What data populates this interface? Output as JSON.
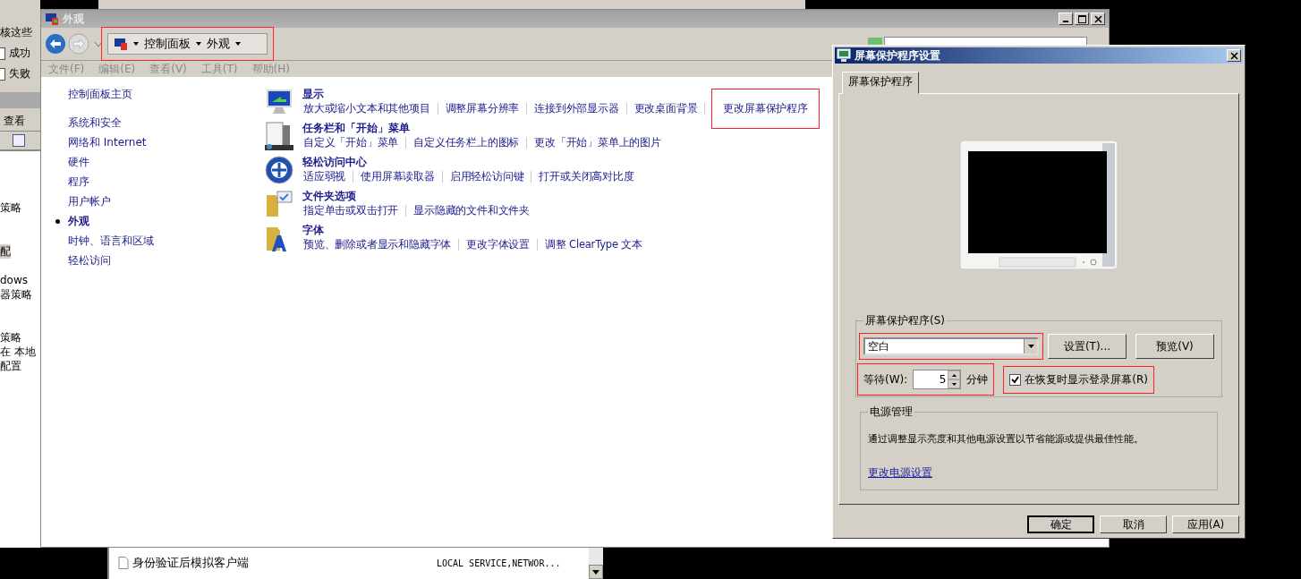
{
  "left_window": {
    "header": "核这些",
    "checkboxes": [
      {
        "label": "成功",
        "checked": false
      },
      {
        "label": "失败",
        "checked": false
      }
    ],
    "menu": [
      "查看"
    ],
    "items": [
      {
        "text": "策略",
        "selected": false
      },
      {
        "text": "配",
        "selected": true
      },
      {
        "text": "dows",
        "selected": false
      },
      {
        "text": "器策略",
        "selected": false
      },
      {
        "text": "策略",
        "selected": false
      },
      {
        "text": "在 本地",
        "selected": false
      },
      {
        "text": "配置",
        "selected": false
      }
    ]
  },
  "list_window": {
    "rows": [
      {
        "name": "身份验证后模拟客户端",
        "column_2": "LOCAL SERVICE,NETWOR..."
      }
    ]
  },
  "main_window": {
    "title": "外观",
    "breadcrumb": {
      "items": [
        "控制面板",
        "外观"
      ],
      "highlighted": true
    },
    "menu": [
      {
        "label": "文件(F)",
        "disabled": true
      },
      {
        "label": "编辑(E)",
        "disabled": true
      },
      {
        "label": "查看(V)",
        "disabled": true
      },
      {
        "label": "工具(T)",
        "disabled": true
      },
      {
        "label": "帮助(H)",
        "disabled": true
      }
    ],
    "sidebar": [
      {
        "label": "控制面板主页",
        "kind": "home",
        "selected": false
      },
      {
        "label": "系统和安全",
        "kind": "link",
        "selected": false
      },
      {
        "label": "网络和 Internet",
        "kind": "link",
        "selected": false
      },
      {
        "label": "硬件",
        "kind": "link",
        "selected": false
      },
      {
        "label": "程序",
        "kind": "link",
        "selected": false
      },
      {
        "label": "用户帐户",
        "kind": "link",
        "selected": false
      },
      {
        "label": "外观",
        "kind": "link",
        "selected": true
      },
      {
        "label": "时钟、语言和区域",
        "kind": "link",
        "selected": false
      },
      {
        "label": "轻松访问",
        "kind": "link",
        "selected": false
      }
    ],
    "categories": [
      {
        "kind": "display",
        "title": "显示",
        "links": [
          {
            "text": "放大或缩小文本和其他项目",
            "highlighted": false
          },
          {
            "text": "调整屏幕分辨率",
            "highlighted": false
          },
          {
            "text": "连接到外部显示器",
            "highlighted": false
          },
          {
            "text": "更改桌面背景",
            "highlighted": false
          },
          {
            "text": "更改屏幕保护程序",
            "highlighted": true
          }
        ]
      },
      {
        "kind": "taskbar",
        "title": "任务栏和「开始」菜单",
        "links": [
          {
            "text": "自定义「开始」菜单",
            "highlighted": false
          },
          {
            "text": "自定义任务栏上的图标",
            "highlighted": false
          },
          {
            "text": "更改「开始」菜单上的图片",
            "highlighted": false
          }
        ]
      },
      {
        "kind": "access",
        "title": "轻松访问中心",
        "links": [
          {
            "text": "适应弱视",
            "highlighted": false
          },
          {
            "text": "使用屏幕读取器",
            "highlighted": false
          },
          {
            "text": "启用轻松访问键",
            "highlighted": false
          },
          {
            "text": "打开或关闭高对比度",
            "highlighted": false
          }
        ]
      },
      {
        "kind": "folder",
        "title": "文件夹选项",
        "links": [
          {
            "text": "指定单击或双击打开",
            "highlighted": false
          },
          {
            "text": "显示隐藏的文件和文件夹",
            "highlighted": false
          }
        ]
      },
      {
        "kind": "fonts",
        "title": "字体",
        "links": [
          {
            "text": "预览、删除或者显示和隐藏字体",
            "highlighted": false
          },
          {
            "text": "更改字体设置",
            "highlighted": false
          },
          {
            "text": "调整 ClearType 文本",
            "highlighted": false
          }
        ]
      }
    ]
  },
  "dialog": {
    "title": "屏幕保护程序设置",
    "tabs": [
      {
        "label": "屏幕保护程序",
        "selected": true
      }
    ],
    "screensaver_group": {
      "label": "屏幕保护程序(S)",
      "value": "空白",
      "highlighted": true,
      "buttons": [
        "设置(T)...",
        "预览(V)"
      ],
      "wait": {
        "label": "等待(W):",
        "value": "5",
        "unit": "分钟",
        "highlighted": true
      },
      "lock": {
        "label": "在恢复时显示登录屏幕(R)",
        "checked": true,
        "highlighted": true
      }
    },
    "power_group": {
      "label": "电源管理",
      "text": "通过调整显示亮度和其他电源设置以节省能源或提供最佳性能。",
      "link": "更改电源设置"
    },
    "buttons": [
      {
        "label": "确定",
        "default": true
      },
      {
        "label": "取消",
        "default": false
      },
      {
        "label": "应用(A)",
        "default": false
      }
    ]
  }
}
